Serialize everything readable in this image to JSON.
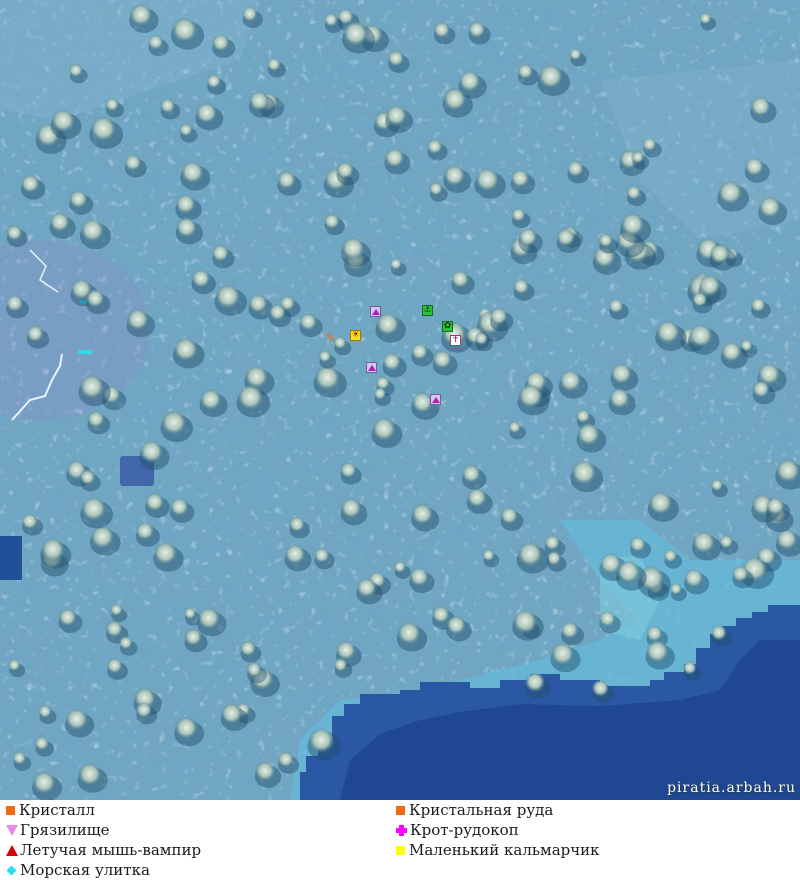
{
  "watermark": "piratia.arbah.ru",
  "legend": {
    "items": [
      {
        "label": "Кристалл",
        "shape": "square",
        "color": "#f06a10",
        "icon": "orange-square-icon"
      },
      {
        "label": "Кристальная руда",
        "shape": "square",
        "color": "#f06a10",
        "icon": "orange-square-icon"
      },
      {
        "label": "Грязилище",
        "shape": "triangle-down",
        "color": "#e88ce8",
        "icon": "pink-triangle-down-icon"
      },
      {
        "label": "Крот-рудокоп",
        "shape": "cross",
        "color": "#ff00ff",
        "icon": "magenta-cross-icon"
      },
      {
        "label": "Летучая мышь-вампир",
        "shape": "triangle-up",
        "color": "#d40000",
        "icon": "red-triangle-up-icon"
      },
      {
        "label": "Маленький кальмарчик",
        "shape": "square",
        "color": "#ffff00",
        "icon": "yellow-square-icon"
      },
      {
        "label": "Морская улитка",
        "shape": "diamond",
        "color": "#22e0f0",
        "icon": "cyan-diamond-icon"
      }
    ]
  },
  "colors": {
    "snow": "#6aa7c6",
    "shallow_water": "#5f9fcc",
    "deep_water": "#2f5fa8",
    "deep_water_dark": "#1d3f86",
    "tree": "#c8d8c8"
  },
  "map_icons": [
    "skill-icon",
    "sun-icon",
    "anchor-icon",
    "bag-icon",
    "chest-icon",
    "mob-triangle-icon"
  ]
}
